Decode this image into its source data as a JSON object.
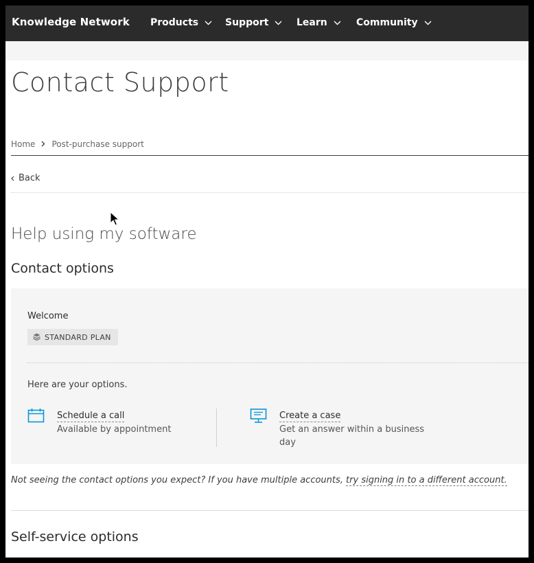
{
  "nav": {
    "brand": "Knowledge Network",
    "items": [
      {
        "label": "Products"
      },
      {
        "label": "Support"
      },
      {
        "label": "Learn"
      },
      {
        "label": "Community"
      }
    ]
  },
  "page": {
    "title": "Contact Support",
    "breadcrumb": [
      "Home",
      "Post-purchase support"
    ],
    "back_label": "Back",
    "section_heading": "Help using my software",
    "contact_heading": "Contact options",
    "self_service_heading": "Self-service options"
  },
  "panel": {
    "welcome": "Welcome",
    "plan_badge": "STANDARD PLAN",
    "intro": "Here are your options.",
    "options": [
      {
        "title": "Schedule a call",
        "desc": "Available by appointment",
        "icon": "calendar-icon"
      },
      {
        "title": "Create a case",
        "desc": "Get an answer within a business day",
        "icon": "monitor-icon"
      }
    ]
  },
  "note": {
    "text": "Not seeing the contact options you expect? If you have multiple accounts, ",
    "link": "try signing in to a different account."
  },
  "colors": {
    "nav_bg": "#2b2b2b",
    "accent_icon": "#0696d7",
    "panel_bg": "#f5f5f5"
  }
}
